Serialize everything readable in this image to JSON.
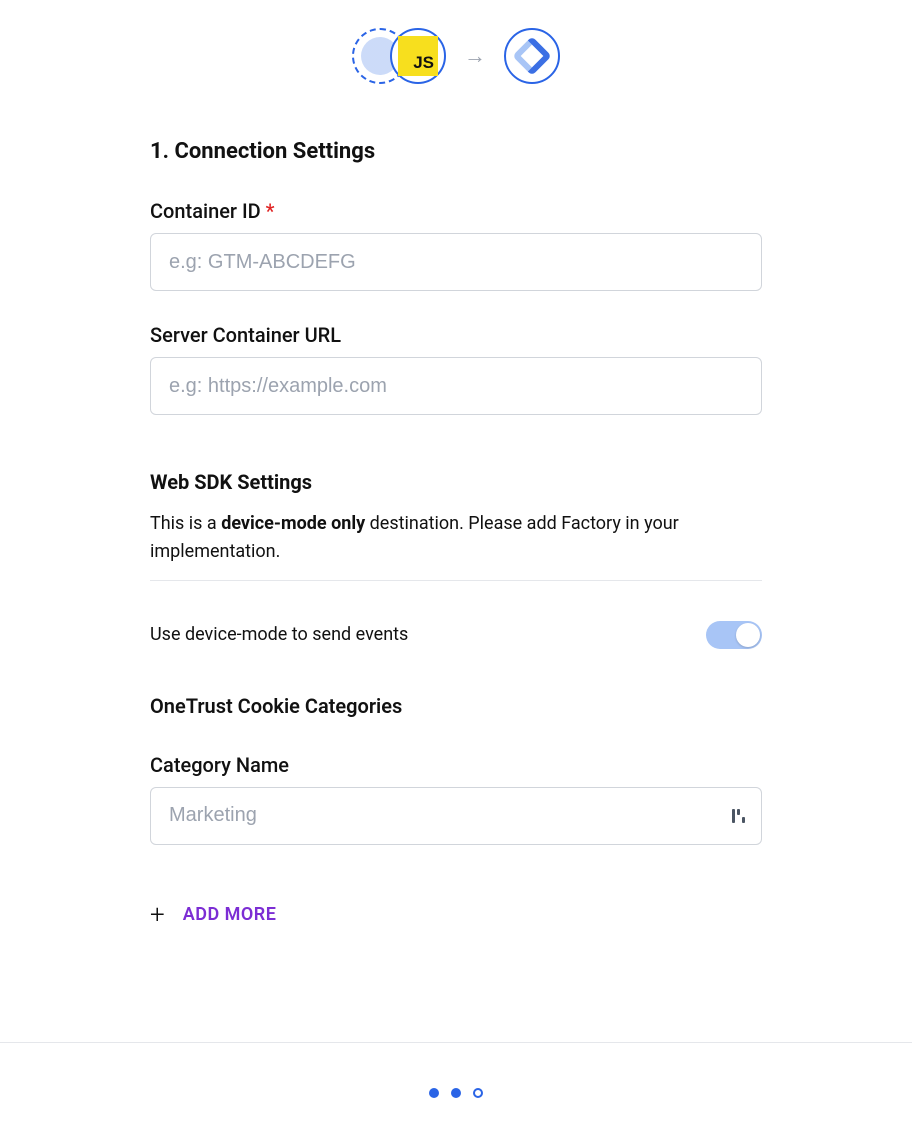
{
  "section_heading": "1. Connection Settings",
  "fields": {
    "container_id": {
      "label": "Container ID",
      "placeholder": "e.g: GTM-ABCDEFG",
      "value": ""
    },
    "server_url": {
      "label": "Server Container URL",
      "placeholder": "e.g: https://example.com",
      "value": ""
    }
  },
  "web_sdk": {
    "heading": "Web SDK Settings",
    "desc_pre": "This is a ",
    "desc_bold": "device-mode only",
    "desc_post": " destination. Please add Factory in your implementation.",
    "toggle_label": "Use device-mode to send events",
    "toggle_on": true
  },
  "onetrust": {
    "heading": "OneTrust Cookie Categories",
    "category_label": "Category Name",
    "category_placeholder": "Marketing",
    "category_value": ""
  },
  "add_more_label": "ADD MORE",
  "js_badge": "JS",
  "pagination": {
    "total": 3,
    "current": 2
  }
}
